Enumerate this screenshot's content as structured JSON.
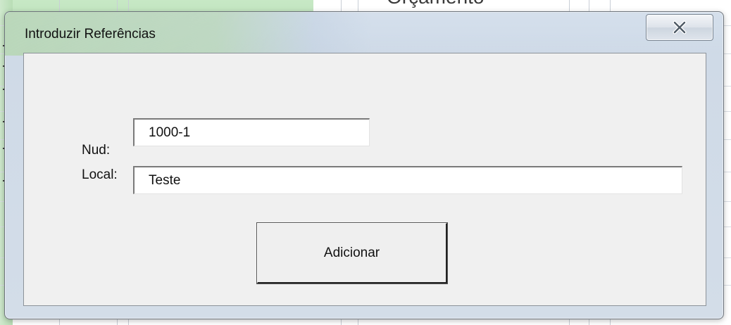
{
  "background": {
    "header_text": "Orçamento"
  },
  "dialog": {
    "title": "Introduzir Referências",
    "close_icon": "close-icon",
    "fields": {
      "nud": {
        "label": "Nud:",
        "value": "1000-1"
      },
      "local": {
        "label": "Local:",
        "value": "Teste"
      }
    },
    "submit_label": "Adicionar"
  },
  "colors": {
    "title_glass_green": "#b6d6b2",
    "dialog_frame": "#c8d6e6",
    "client_bg": "#f0f0f0"
  }
}
